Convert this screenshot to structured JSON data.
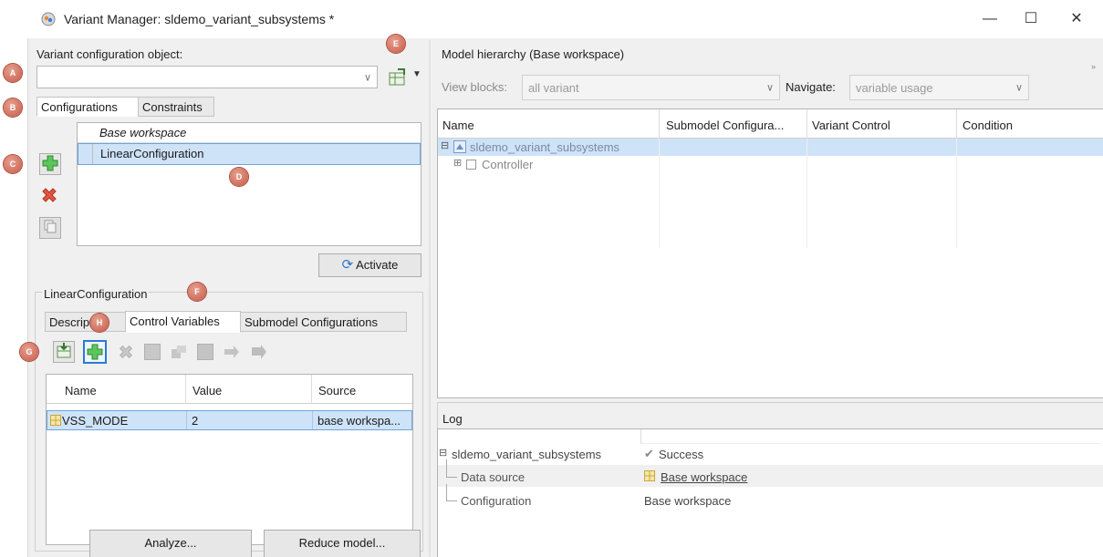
{
  "window": {
    "title": "Variant Manager: sldemo_variant_subsystems *",
    "min_glyph": "—",
    "max_glyph": "☐",
    "close_glyph": "✕"
  },
  "left": {
    "config_object_label": "Variant configuration object:",
    "config_object_value": "",
    "tabs": [
      "Configurations",
      "Constraints"
    ],
    "config_list": {
      "header": "Base workspace",
      "rows": [
        "LinearConfiguration"
      ]
    },
    "activate_label": "Activate",
    "selected_config_title": "LinearConfiguration",
    "sub_tabs": [
      "Description",
      "Control Variables",
      "Submodel Configurations"
    ],
    "vars_table": {
      "columns": [
        "Name",
        "Value",
        "Source"
      ],
      "rows": [
        {
          "name": "VSS_MODE",
          "value": "2",
          "source": "base workspa..."
        }
      ]
    },
    "analyze_label": "Analyze...",
    "reduce_label": "Reduce model..."
  },
  "right": {
    "hierarchy_title": "Model hierarchy (Base workspace)",
    "view_blocks_label": "View blocks:",
    "view_blocks_value": "all variant",
    "navigate_label": "Navigate:",
    "navigate_value": "variable usage",
    "tree_columns": [
      "Name",
      "Submodel Configura...",
      "Variant Control",
      "Condition"
    ],
    "tree_rows": [
      {
        "name": "sldemo_variant_subsystems"
      },
      {
        "name": "Controller"
      }
    ],
    "log": {
      "title": "Log",
      "rows": [
        {
          "name": "sldemo_variant_subsystems",
          "value": "Success"
        },
        {
          "name": "Data source",
          "value": "Base workspace"
        },
        {
          "name": "Configuration",
          "value": "Base workspace"
        }
      ]
    }
  },
  "markers": [
    "A",
    "B",
    "C",
    "D",
    "E",
    "F",
    "G",
    "H"
  ],
  "colors": {
    "accent_selection": "#cfe3f8",
    "marker": "#c55a4a",
    "add_green": "#3aa53a",
    "delete_red": "#d23a2a"
  }
}
